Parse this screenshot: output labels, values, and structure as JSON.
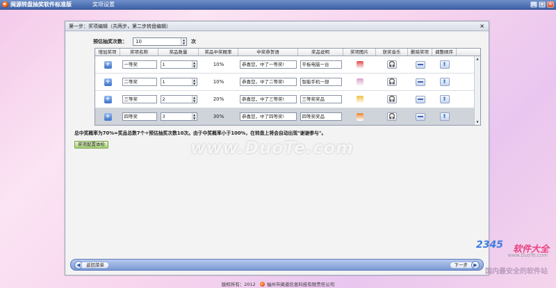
{
  "window": {
    "app_title": "闽源转盘抽奖软件标准版",
    "menu": [
      "奖项设置"
    ],
    "controls": {
      "minimize": "_",
      "maximize": "□",
      "close": "×"
    }
  },
  "panel": {
    "title": "第一步：奖项编辑（共两步，第二步转盘编辑）",
    "close": "×",
    "draw_count_label": "预估抽奖次数：",
    "draw_count_value": "10",
    "draw_count_unit": "次"
  },
  "table": {
    "headers": [
      "增加奖项",
      "奖项名称",
      "奖品数量",
      "奖品中奖概率",
      "中奖恭贺语",
      "奖品说明",
      "奖项图片",
      "获奖音乐",
      "删除奖项",
      "调整顺序"
    ],
    "rows": [
      {
        "name": "一等奖",
        "qty": "1",
        "prob": "10%",
        "greeting": "恭喜您，中了一等奖!",
        "desc": "平板电脑一台",
        "img_color": "#e04848",
        "selected": false
      },
      {
        "name": "二等奖",
        "qty": "1",
        "prob": "10%",
        "greeting": "恭喜您，中了二等奖!",
        "desc": "智能手机一部",
        "img_color": "#d9a0c8",
        "selected": false
      },
      {
        "name": "三等奖",
        "qty": "2",
        "prob": "20%",
        "greeting": "恭喜您，中了三等奖!",
        "desc": "三等奖奖品",
        "img_color": "#f0c040",
        "selected": false
      },
      {
        "name": "四等奖",
        "qty": "3",
        "prob": "30%",
        "greeting": "恭喜您，中了四等奖!",
        "desc": "四等奖奖品",
        "img_color": "#e8862a",
        "selected": true
      }
    ],
    "icons": {
      "add": "plus-icon",
      "music": "headphones-icon",
      "delete": "minus-icon",
      "move": "arrow-up-icon"
    }
  },
  "summary": "总中奖概率为70%=奖品总数7个÷预估抽奖次数10次。由于中奖概率小于100%，在转盘上将会自动出现\"谢谢参与\"。",
  "check_button": "奖项配置体检",
  "watermark": "www.DuoTe.com",
  "nav": {
    "back": "返回菜单",
    "next": "下一步"
  },
  "footer": {
    "copyright": "版权所有：2012",
    "company": "福州市闽道信息科技有限责任公司"
  },
  "brand": {
    "number": "2345",
    "name": "软件大全",
    "url": "www.DuoTe.com",
    "slogan": "国内最安全的软件站"
  },
  "colors": {
    "titlebar": "#3f62a8",
    "accent": "#3e73c9"
  }
}
